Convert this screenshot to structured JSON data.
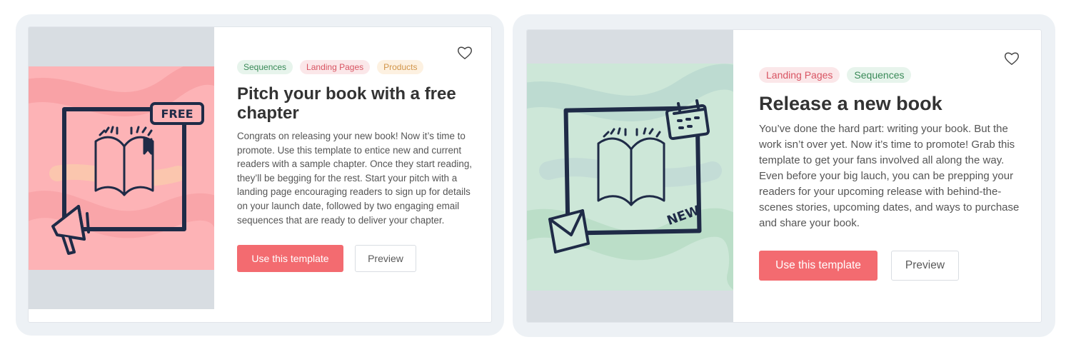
{
  "colors": {
    "accent": "#f36b70",
    "tag_green_text": "#3a8a58",
    "tag_red_text": "#d85462",
    "tag_orange_text": "#d1954a",
    "card1_art_bg": "#fdb3b6",
    "card2_art_bg": "#cde7d8",
    "ink": "#1f2b47"
  },
  "cards": [
    {
      "tags": [
        {
          "label": "Sequences",
          "color": "green"
        },
        {
          "label": "Landing Pages",
          "color": "red"
        },
        {
          "label": "Products",
          "color": "orange"
        }
      ],
      "title": "Pitch your book with a free chapter",
      "description": "Congrats on releasing your new book! Now it’s time to promote. Use this template to entice new and current readers with a sample chapter. Once they start reading, they’ll be begging for the rest. Start your pitch with a landing page encouraging readers to sign up for details on your launch date, followed by two engaging email sequences that are ready to deliver your chapter.",
      "primary_label": "Use this template",
      "secondary_label": "Preview",
      "art_badge": "FREE",
      "favorite_icon": "heart-outline-icon",
      "art_icons": [
        "open-book-icon",
        "megaphone-icon"
      ]
    },
    {
      "tags": [
        {
          "label": "Landing Pages",
          "color": "red"
        },
        {
          "label": "Sequences",
          "color": "green"
        }
      ],
      "title": "Release a new book",
      "description": "You’ve done the hard part: writing your book. But the work isn’t over yet. Now it’s time to promote! Grab this template to get your fans involved all along the way. Even before your big lauch, you can be prepping your readers for your upcoming release with behind-the-scenes stories, upcoming dates, and ways to purchase and share your book.",
      "primary_label": "Use this template",
      "secondary_label": "Preview",
      "art_badge": "NEW",
      "favorite_icon": "heart-outline-icon",
      "art_icons": [
        "open-book-icon",
        "calendar-icon",
        "envelope-icon"
      ]
    }
  ]
}
